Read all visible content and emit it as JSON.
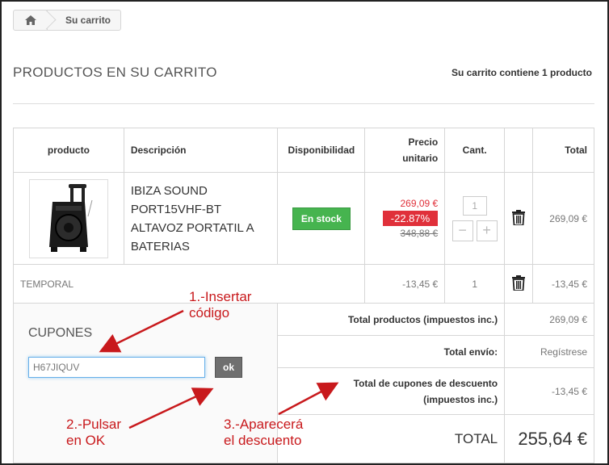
{
  "breadcrumb": {
    "home_icon": "home-icon",
    "current": "Su carrito"
  },
  "page": {
    "title": "PRODUCTOS EN SU CARRITO",
    "cart_summary": "Su carrito contiene 1 producto"
  },
  "table": {
    "headers": {
      "product": "producto",
      "description": "Descripción",
      "availability": "Disponibilidad",
      "unit_price_line1": "Precio",
      "unit_price_line2": "unitario",
      "qty": "Cant.",
      "total": "Total"
    },
    "product": {
      "description": "IBIZA SOUND PORT15VHF-BT ALTAVOZ PORTATIL A BATERIAS",
      "stock": "En stock",
      "price_new": "269,09 €",
      "price_discount": "-22.87%",
      "price_old": "348,88 €",
      "qty": "1",
      "minus": "−",
      "plus": "+",
      "total": "269,09 €"
    },
    "voucher": {
      "name": "TEMPORAL",
      "unit_price": "-13,45 €",
      "qty": "1",
      "total": "-13,45 €"
    },
    "totals": {
      "products_label": "Total productos (impuestos inc.)",
      "products_value": "269,09 €",
      "shipping_label": "Total envío:",
      "shipping_value": "Regístrese",
      "coupons_label_line1": "Total de cupones de descuento",
      "coupons_label_line2": "(impuestos inc.)",
      "coupons_value": "-13,45 €",
      "grand_label": "TOTAL",
      "grand_value": "255,64 €"
    },
    "coupons": {
      "title": "CUPONES",
      "input_value": "H67JIQUV",
      "ok_label": "ok"
    }
  },
  "annotations": {
    "step1_line1": "1.-Insertar",
    "step1_line2": "código",
    "step2_line1": "2.-Pulsar",
    "step2_line2": "en OK",
    "step3_line1": "3.-Aparecerá",
    "step3_line2": "el descuento"
  },
  "colors": {
    "accent_red": "#c8191c",
    "stock_green": "#46b44f",
    "discount_red": "#e0303a"
  }
}
